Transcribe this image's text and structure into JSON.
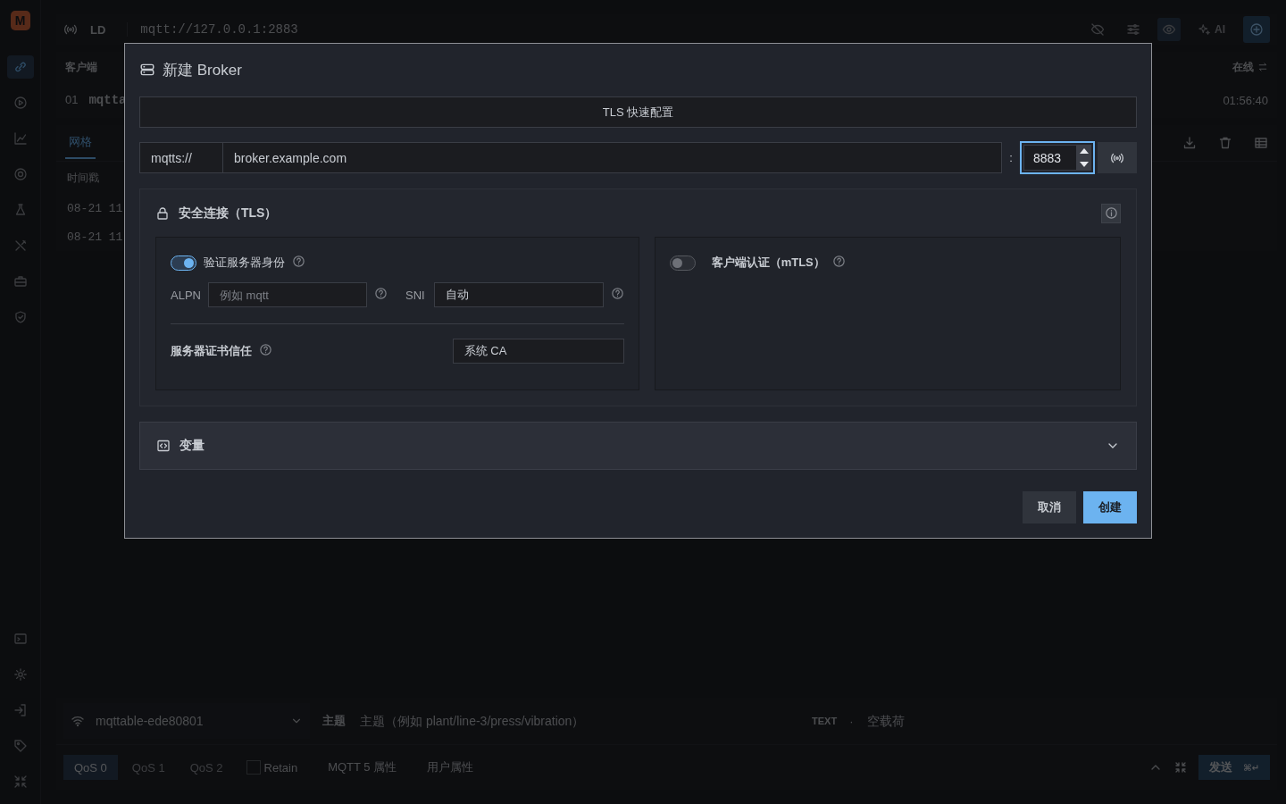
{
  "app": {
    "logo": "M",
    "nav": [
      {
        "selected": true
      },
      {
        "selected": false
      },
      {
        "selected": false
      },
      {
        "selected": false
      },
      {
        "selected": false
      },
      {
        "selected": false
      },
      {
        "selected": false
      },
      {
        "selected": false
      }
    ],
    "toolbar": {
      "connection_label": "LD",
      "url": "mqtt://127.0.0.1:2883",
      "ai_label": "AI",
      "buttons": [
        {
          "kind": "hide",
          "selected": false
        },
        {
          "kind": "filter",
          "selected": false
        },
        {
          "kind": "view",
          "selected": true
        }
      ]
    },
    "clients": {
      "header": "客户端",
      "status": "在线",
      "rows": [
        {
          "index": "01",
          "name": "mqtta",
          "time": "01:56:40"
        }
      ]
    },
    "tabs": [
      {
        "label": "网格",
        "selected": true
      }
    ],
    "log": {
      "columns": [
        "时间戳"
      ],
      "rows": [
        "08-21 11",
        "08-21 11"
      ]
    },
    "composer": {
      "client": "mqttable-ede80801",
      "topic_label": "主题",
      "topic_placeholder": "主题（例如 plant/line-3/press/vibration）",
      "format": "TEXT",
      "separator": "·",
      "payload_placeholder": "空载荷",
      "qos": [
        {
          "label": "QoS 0",
          "selected": true
        },
        {
          "label": "QoS 1",
          "selected": false
        },
        {
          "label": "QoS 2",
          "selected": false
        }
      ],
      "retain": {
        "label": "Retain",
        "checked": false
      },
      "mqtt5": "MQTT 5 属性",
      "user_props": "用户属性",
      "send": "发送",
      "send_shortcut": "⌘↵"
    }
  },
  "dialog": {
    "title": "新建 Broker",
    "tls_quick": "TLS 快速配置",
    "scheme": "mqtts://",
    "host": "broker.example.com",
    "port_separator": ":",
    "port": "8883",
    "tls": {
      "title": "安全连接（TLS）",
      "verify_server": {
        "label": "验证服务器身份",
        "on": true
      },
      "alpn": {
        "label": "ALPN",
        "placeholder": "例如 mqtt"
      },
      "sni": {
        "label": "SNI",
        "value": "自动"
      },
      "trust": {
        "label": "服务器证书信任",
        "value": "系统 CA"
      },
      "mtls": {
        "label": "客户端认证（mTLS）",
        "on": false
      }
    },
    "variables": {
      "title": "变量",
      "expanded": false
    },
    "buttons": [
      {
        "label": "取消",
        "kind": "secondary"
      },
      {
        "label": "创建",
        "kind": "primary"
      }
    ]
  }
}
